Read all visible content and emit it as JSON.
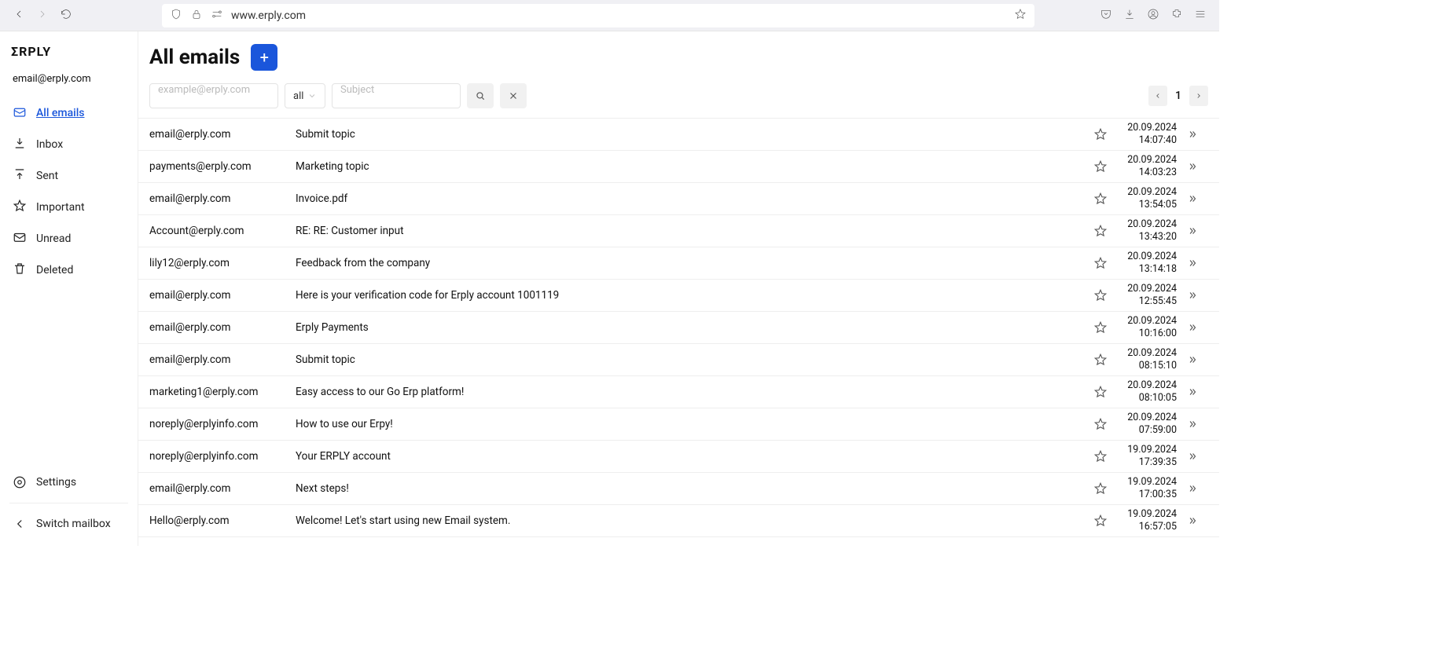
{
  "browser": {
    "url": "www.erply.com"
  },
  "app": {
    "logo": "ΣRPLY",
    "account_email": "email@erply.com",
    "page_title": "All emails",
    "compose_label": "+",
    "sidebar": [
      {
        "key": "all",
        "label": "All emails",
        "active": true
      },
      {
        "key": "inbox",
        "label": "Inbox",
        "active": false
      },
      {
        "key": "sent",
        "label": "Sent",
        "active": false
      },
      {
        "key": "important",
        "label": "Important",
        "active": false
      },
      {
        "key": "unread",
        "label": "Unread",
        "active": false
      },
      {
        "key": "deleted",
        "label": "Deleted",
        "active": false
      }
    ],
    "settings_label": "Settings",
    "switch_label": "Switch mailbox",
    "filters": {
      "sender_placeholder": "example@erply.com",
      "type_selected": "all",
      "subject_placeholder": "Subject"
    },
    "pagination": {
      "page": "1"
    },
    "emails": [
      {
        "sender": "email@erply.com",
        "subject": "Submit topic",
        "date": "20.09.2024",
        "time": "14:07:40"
      },
      {
        "sender": "payments@erply.com",
        "subject": " Marketing topic",
        "date": "20.09.2024",
        "time": "14:03:23"
      },
      {
        "sender": "email@erply.com",
        "subject": "Invoice.pdf",
        "date": "20.09.2024",
        "time": "13:54:05"
      },
      {
        "sender": "Account@erply.com",
        "subject": "RE: RE: Customer input",
        "date": "20.09.2024",
        "time": "13:43:20"
      },
      {
        "sender": "lily12@erply.com",
        "subject": "Feedback from the company",
        "date": "20.09.2024",
        "time": "13:14:18"
      },
      {
        "sender": "email@erply.com",
        "subject": "Here is your verification code for Erply account 1001119",
        "date": "20.09.2024",
        "time": "12:55:45"
      },
      {
        "sender": "email@erply.com",
        "subject": "Erply Payments",
        "date": "20.09.2024",
        "time": "10:16:00"
      },
      {
        "sender": "email@erply.com",
        "subject": "Submit topic",
        "date": "20.09.2024",
        "time": "08:15:10"
      },
      {
        "sender": "marketing1@erply.com",
        "subject": "Easy access to our Go Erp platform!",
        "date": "20.09.2024",
        "time": "08:10:05"
      },
      {
        "sender": "noreply@erplyinfo.com",
        "subject": "How to use our Erpy!",
        "date": "20.09.2024",
        "time": "07:59:00"
      },
      {
        "sender": "noreply@erplyinfo.com",
        "subject": "Your ERPLY account",
        "date": "19.09.2024",
        "time": "17:39:35"
      },
      {
        "sender": "email@erply.com",
        "subject": "Next steps!",
        "date": "19.09.2024",
        "time": "17:00:35"
      },
      {
        "sender": "Hello@erply.com",
        "subject": "Welcome! Let's start using new Email system.",
        "date": "19.09.2024",
        "time": "16:57:05"
      }
    ]
  }
}
